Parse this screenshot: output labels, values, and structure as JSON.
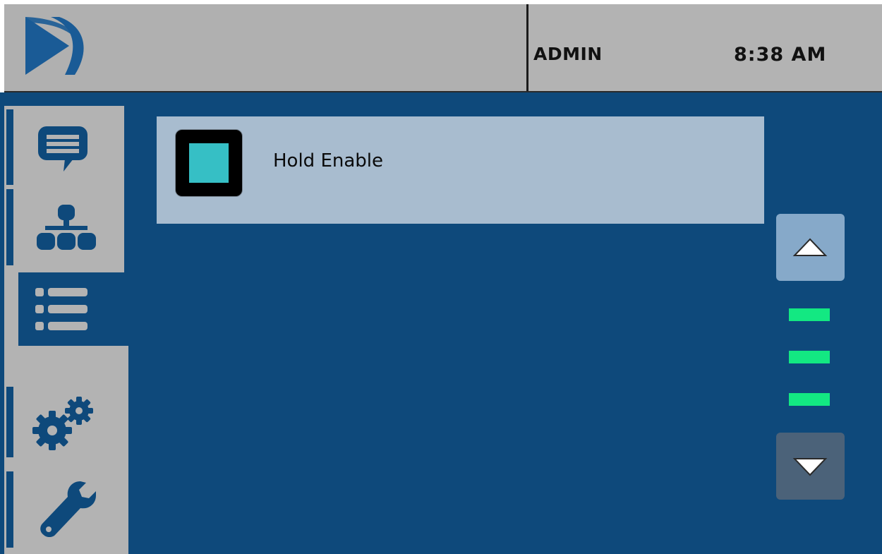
{
  "header": {
    "logo": "company-logo",
    "user": "ADMIN",
    "time": "8:38 AM"
  },
  "sidebar": {
    "items": [
      {
        "icon": "message-icon",
        "active": false
      },
      {
        "icon": "network-icon",
        "active": false
      },
      {
        "icon": "list-icon",
        "active": true
      },
      {
        "icon": "gears-icon",
        "active": false
      },
      {
        "icon": "wrench-icon",
        "active": false
      }
    ]
  },
  "list": {
    "items": [
      {
        "label": "Hold Enable",
        "checked": true
      }
    ]
  },
  "pager": {
    "up_icon": "triangle-up-icon",
    "down_icon": "triangle-down-icon",
    "indicator_count": 3
  },
  "colors": {
    "background": "#0e497b",
    "header": "#b3b3b3",
    "row": "#a8bccf",
    "checkbox_fill": "#36bfc5",
    "indicator": "#13e882",
    "icon_blue": "#0e497b"
  }
}
